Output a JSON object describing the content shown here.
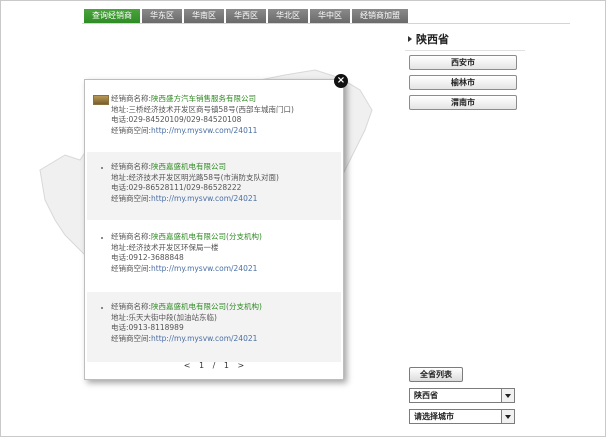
{
  "tabs": [
    {
      "label": "查询经销商",
      "active": true
    },
    {
      "label": "华东区",
      "active": false
    },
    {
      "label": "华南区",
      "active": false
    },
    {
      "label": "华西区",
      "active": false
    },
    {
      "label": "华北区",
      "active": false
    },
    {
      "label": "华中区",
      "active": false
    },
    {
      "label": "经销商加盟",
      "active": false
    }
  ],
  "right_panel": {
    "province": "陕西省",
    "cities": [
      "西安市",
      "榆林市",
      "渭南市"
    ]
  },
  "popup": {
    "close_label": "×",
    "dealers": [
      {
        "name_label": "经销商名称:",
        "name": "陕西盛方汽车销售服务有限公司",
        "address_label": "地址:",
        "address": "三桥经济技术开发区商号镇58号(西部车城南门口)",
        "phone_label": "电话:",
        "phone": "029-84520109/029-84520108",
        "space_label": "经销商空间:",
        "space": "http://my.mysvw.com/24011"
      },
      {
        "name_label": "经销商名称:",
        "name": "陕西嘉盛机电有限公司",
        "address_label": "地址:",
        "address": "经济技术开发区明光路58号(市消防支队对面)",
        "phone_label": "电话:",
        "phone": "029-86528111/029-86528222",
        "space_label": "经销商空间:",
        "space": "http://my.mysvw.com/24021"
      },
      {
        "name_label": "经销商名称:",
        "name": "陕西嘉盛机电有限公司(分支机构)",
        "address_label": "地址:",
        "address": "经济技术开发区环保局一楼",
        "phone_label": "电话:",
        "phone": "0912-3688848",
        "space_label": "经销商空间:",
        "space": "http://my.mysvw.com/24021"
      },
      {
        "name_label": "经销商名称:",
        "name": "陕西嘉盛机电有限公司(分支机构)",
        "address_label": "地址:",
        "address": "乐天大街中段(加油站东临)",
        "phone_label": "电话:",
        "phone": "0913-8118989",
        "space_label": "经销商空间:",
        "space": "http://my.mysvw.com/24021"
      }
    ],
    "pager": {
      "prev": "<",
      "current": "1",
      "sep": "/",
      "total": "1",
      "next": ">"
    }
  },
  "bottom_controls": {
    "all_list_label": "全省列表",
    "province_select": "陕西省",
    "city_select": "请选择城市"
  },
  "colors": {
    "active_tab": "#3a9a2f",
    "inactive_tab": "#7a7a7a",
    "dealer_name_link": "#2f8a23"
  }
}
